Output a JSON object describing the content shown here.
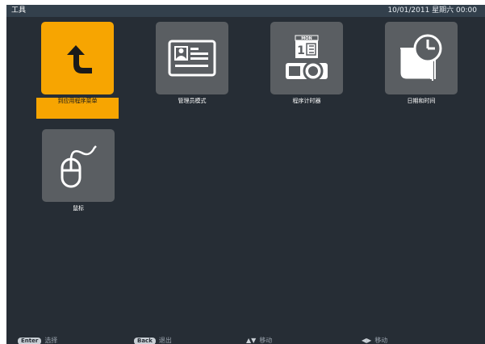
{
  "title_bar": {
    "title": "工具",
    "datetime": "10/01/2011 星期六 00:00"
  },
  "tiles": [
    {
      "label": "到应用程序菜单",
      "icon": "return-arrow-icon",
      "selected": true
    },
    {
      "label": "管理员模式",
      "icon": "id-card-icon",
      "selected": false
    },
    {
      "label": "程序计时器",
      "icon": "calendar-projector-icon",
      "selected": false
    },
    {
      "label": "日期和时间",
      "icon": "clock-note-icon",
      "selected": false
    },
    {
      "label": "鼠标",
      "icon": "mouse-icon",
      "selected": false
    }
  ],
  "status_bar": [
    {
      "key": "Enter",
      "text": "选择"
    },
    {
      "key": "Back",
      "text": "退出"
    },
    {
      "key": "▲▼",
      "text": "移动"
    },
    {
      "key": "◀▶",
      "text": "移动"
    }
  ],
  "colors": {
    "background": "#262d35",
    "title_bar": "#33404c",
    "tile": "#5a5e62",
    "selected": "#f7a501"
  }
}
